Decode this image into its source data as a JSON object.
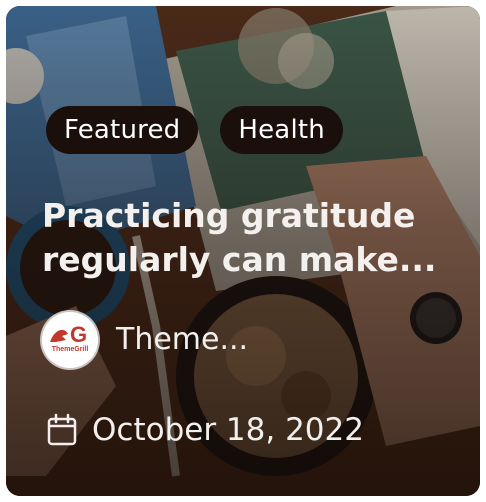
{
  "card": {
    "tags": [
      {
        "label": "Featured"
      },
      {
        "label": "Health"
      }
    ],
    "title": "Practicing gratitude regularly can make...",
    "author": {
      "name": "Theme...",
      "avatar_logo_letter": "G",
      "avatar_logo_sub": "ThemeGrill"
    },
    "date": "October 18, 2022",
    "icons": {
      "calendar": "calendar-icon"
    },
    "colors": {
      "tag_bg": "#1a0f0b",
      "text": "#f2efed",
      "logo_red": "#c0392b"
    }
  }
}
